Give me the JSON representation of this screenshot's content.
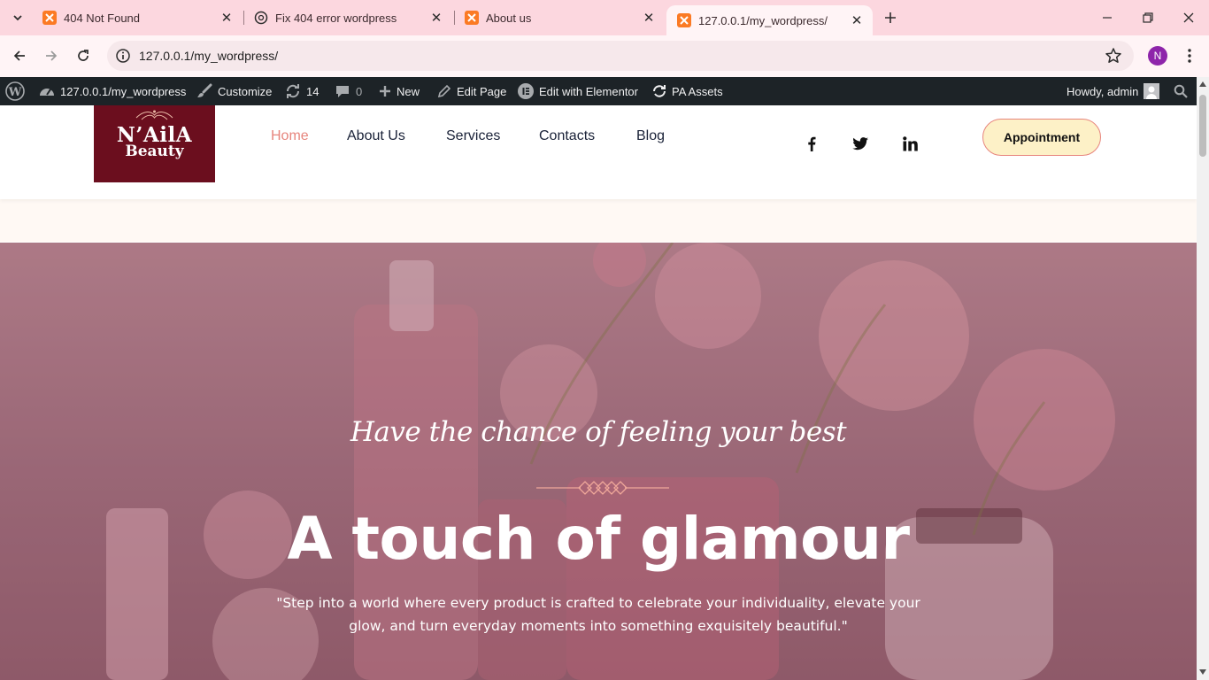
{
  "browser": {
    "tabs": [
      {
        "title": "404 Not Found",
        "icon": "xampp-icon",
        "active": false
      },
      {
        "title": "Fix 404 error wordpress",
        "icon": "chatgpt-icon",
        "active": false
      },
      {
        "title": "About us",
        "icon": "xampp-icon",
        "active": false
      },
      {
        "title": "127.0.0.1/my_wordpress/",
        "icon": "xampp-icon",
        "active": true
      }
    ],
    "url": "127.0.0.1/my_wordpress/",
    "profile_initial": "N"
  },
  "admin_bar": {
    "site_name": "127.0.0.1/my_wordpress",
    "customize": "Customize",
    "updates_count": "14",
    "comments_count": "0",
    "new": "New",
    "edit_page": "Edit Page",
    "edit_elementor": "Edit with Elementor",
    "pa_assets": "PA Assets",
    "howdy": "Howdy, admin"
  },
  "site": {
    "logo": {
      "line1": "N’AilA",
      "line2": "Beauty"
    },
    "nav": [
      {
        "label": "Home",
        "active": true
      },
      {
        "label": "About Us",
        "active": false
      },
      {
        "label": "Services",
        "active": false
      },
      {
        "label": "Contacts",
        "active": false
      },
      {
        "label": "Blog",
        "active": false
      }
    ],
    "social": [
      "facebook-icon",
      "twitter-icon",
      "linkedin-icon"
    ],
    "appointment_label": "Appointment"
  },
  "hero": {
    "tagline": "Have the chance of feeling your best",
    "title": "A touch of glamour",
    "text": "\"Step into a world where every product is crafted to celebrate your individuality, elevate your glow, and turn everyday moments into something exquisitely beautiful.\""
  },
  "colors": {
    "accent": "#e7857d",
    "tabstrip": "#fcd7df",
    "admin_bar": "#1d2327",
    "logo_bg": "#6b0e1e",
    "appointment_bg": "#fdf1c7"
  }
}
